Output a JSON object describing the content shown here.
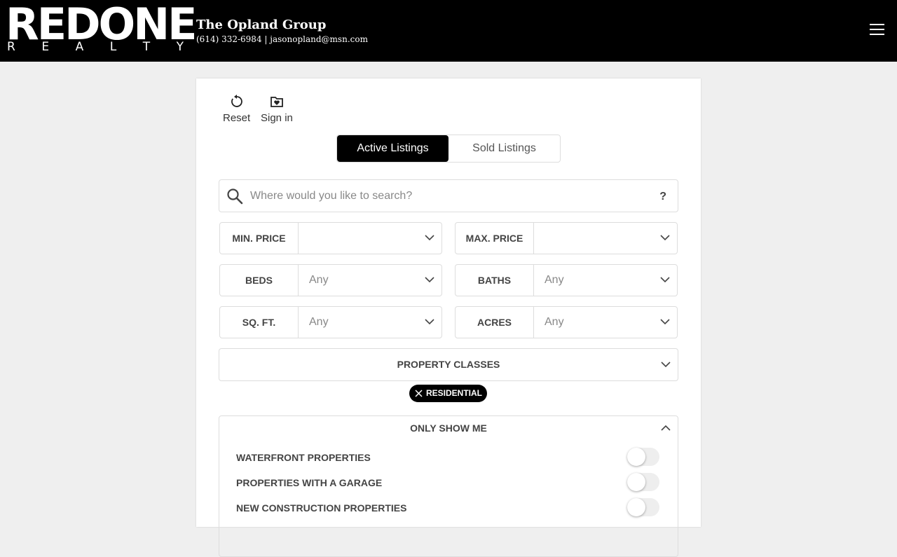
{
  "header": {
    "logo_main": "REDONE",
    "logo_sub": [
      "R",
      "E",
      "A",
      "L",
      "T",
      "Y"
    ],
    "agent_name": "The Opland Group",
    "agent_contact": "(614) 332-6984 | jasonopland@msn.com"
  },
  "toolbar": {
    "reset_label": "Reset",
    "signin_label": "Sign in"
  },
  "listing_tabs": {
    "active": "Active Listings",
    "sold": "Sold Listings"
  },
  "search": {
    "placeholder": "Where would you like to search?",
    "value": "",
    "help": "?"
  },
  "filters": {
    "min_price": {
      "label": "MIN. PRICE",
      "value": ""
    },
    "max_price": {
      "label": "MAX. PRICE",
      "value": ""
    },
    "beds": {
      "label": "BEDS",
      "value": "Any"
    },
    "baths": {
      "label": "BATHS",
      "value": "Any"
    },
    "sqft": {
      "label": "SQ. FT.",
      "value": "Any"
    },
    "acres": {
      "label": "ACRES",
      "value": "Any"
    }
  },
  "property_classes": {
    "label": "PROPERTY CLASSES",
    "selected_chip": "RESIDENTIAL"
  },
  "only_show_me": {
    "label": "ONLY SHOW ME",
    "options": [
      {
        "label": "WATERFRONT PROPERTIES",
        "enabled": false
      },
      {
        "label": "PROPERTIES WITH A GARAGE",
        "enabled": false
      },
      {
        "label": "NEW CONSTRUCTION PROPERTIES",
        "enabled": false
      }
    ]
  },
  "colors": {
    "header_bg": "#000000",
    "accent": "#000000",
    "page_bg": "#efefef"
  }
}
